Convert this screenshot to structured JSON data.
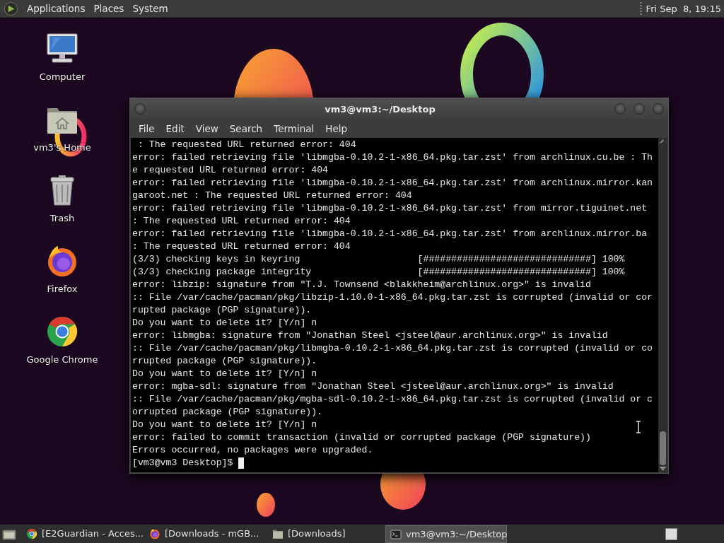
{
  "top_panel": {
    "menus": [
      "Applications",
      "Places",
      "System"
    ],
    "clock": "Fri Sep  8, 19:15"
  },
  "desktop_icons": [
    {
      "kind": "computer",
      "label": "Computer"
    },
    {
      "kind": "home",
      "label": "vm3's Home"
    },
    {
      "kind": "trash",
      "label": "Trash"
    },
    {
      "kind": "firefox",
      "label": "Firefox"
    },
    {
      "kind": "chrome",
      "label": "Google Chrome"
    }
  ],
  "terminal": {
    "title": "vm3@vm3:~/Desktop",
    "menu": [
      "File",
      "Edit",
      "View",
      "Search",
      "Terminal",
      "Help"
    ],
    "lines": [
      " : The requested URL returned error: 404",
      "error: failed retrieving file 'libmgba-0.10.2-1-x86_64.pkg.tar.zst' from archlinux.cu.be : Th",
      "e requested URL returned error: 404",
      "error: failed retrieving file 'libmgba-0.10.2-1-x86_64.pkg.tar.zst' from archlinux.mirror.kan",
      "garoot.net : The requested URL returned error: 404",
      "error: failed retrieving file 'libmgba-0.10.2-1-x86_64.pkg.tar.zst' from mirror.tiguinet.net",
      ": The requested URL returned error: 404",
      "error: failed retrieving file 'libmgba-0.10.2-1-x86_64.pkg.tar.zst' from archlinux.mirror.ba",
      ": The requested URL returned error: 404",
      "(3/3) checking keys in keyring                     [##############################] 100%",
      "(3/3) checking package integrity                   [##############################] 100%",
      "error: libzip: signature from \"T.J. Townsend <blakkheim@archlinux.org>\" is invalid",
      ":: File /var/cache/pacman/pkg/libzip-1.10.0-1-x86_64.pkg.tar.zst is corrupted (invalid or cor",
      "rupted package (PGP signature)).",
      "Do you want to delete it? [Y/n] n",
      "error: libmgba: signature from \"Jonathan Steel <jsteel@aur.archlinux.org>\" is invalid",
      ":: File /var/cache/pacman/pkg/libmgba-0.10.2-1-x86_64.pkg.tar.zst is corrupted (invalid or co",
      "rrupted package (PGP signature)).",
      "Do you want to delete it? [Y/n] n",
      "error: mgba-sdl: signature from \"Jonathan Steel <jsteel@aur.archlinux.org>\" is invalid",
      ":: File /var/cache/pacman/pkg/mgba-sdl-0.10.2-1-x86_64.pkg.tar.zst is corrupted (invalid or c",
      "orrupted package (PGP signature)).",
      "Do you want to delete it? [Y/n] n",
      "error: failed to commit transaction (invalid or corrupted package (PGP signature))",
      "Errors occurred, no packages were upgraded."
    ],
    "prompt": "[vm3@vm3 Desktop]$"
  },
  "taskbar": {
    "items": [
      {
        "kind": "chrome",
        "label": "[E2Guardian - Acces...",
        "selected": false
      },
      {
        "kind": "firefox",
        "label": "[Downloads - mGB...",
        "selected": false
      },
      {
        "kind": "folder",
        "label": "[Downloads]",
        "selected": false
      },
      {
        "kind": "terminal",
        "label": "vm3@vm3:~/Desktop",
        "selected": true
      }
    ]
  }
}
